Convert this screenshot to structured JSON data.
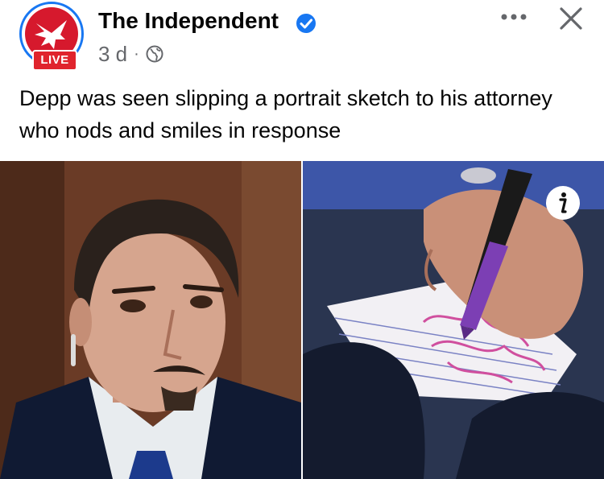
{
  "post": {
    "page_name": "The Independent",
    "live_label": "LIVE",
    "time": "3 d",
    "separator": "·",
    "text": "Depp was seen slipping a portrait sketch to his attorney who nods and smiles in response"
  },
  "icons": {
    "verified": "verified-badge-icon",
    "audience": "globe-icon",
    "more": "more-options-icon",
    "close": "close-icon",
    "info": "info-icon"
  },
  "colors": {
    "verified_blue": "#1877f2",
    "live_red": "#e0242d",
    "meta_gray": "#65676b"
  }
}
